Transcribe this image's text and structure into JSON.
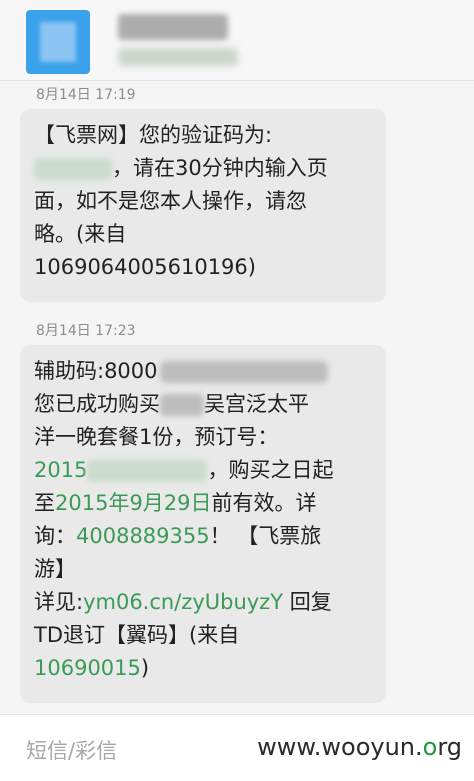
{
  "header": {
    "contact_name": "",
    "contact_number": ""
  },
  "messages": [
    {
      "timestamp": "8月14日 17:19",
      "lines": [
        "【飞票网】您的验证码为:",
        "，请在30分钟内输入页",
        "面，如不是您本人操作，请忽",
        "略。(来自",
        "1069064005610196)"
      ]
    },
    {
      "timestamp": "8月14日 17:23",
      "lines": {
        "l1": "辅助码:8000",
        "l2a": "您已成功购买",
        "l2b": "吴宫泛太平",
        "l3": "洋一晚套餐1份，预订号：",
        "l4a": "2015",
        "l4b": "，购买之日起",
        "l5a": "至",
        "l5date": "2015年9月29日",
        "l5b": "前有效。详",
        "l6a": "询：",
        "l6phone": "4008889355",
        "l6b": "！ 【飞票旅",
        "l7": "游】",
        "l8a": "详见:",
        "l8url": "ym06.cn/zyUbuyzY",
        "l8b": " 回复",
        "l9": "TD退订【翼码】(来自",
        "l10num": "10690015",
        "l10b": ")"
      }
    }
  ],
  "composer": {
    "placeholder": "短信/彩信"
  },
  "watermark": {
    "prefix": "www.wooyun.",
    "suffix_o": "o",
    "suffix_rest": "rg"
  },
  "colors": {
    "link_green": "#3b9b56",
    "bubble_bg": "#e9e9e9",
    "avatar_blue": "#3aa2ea"
  }
}
